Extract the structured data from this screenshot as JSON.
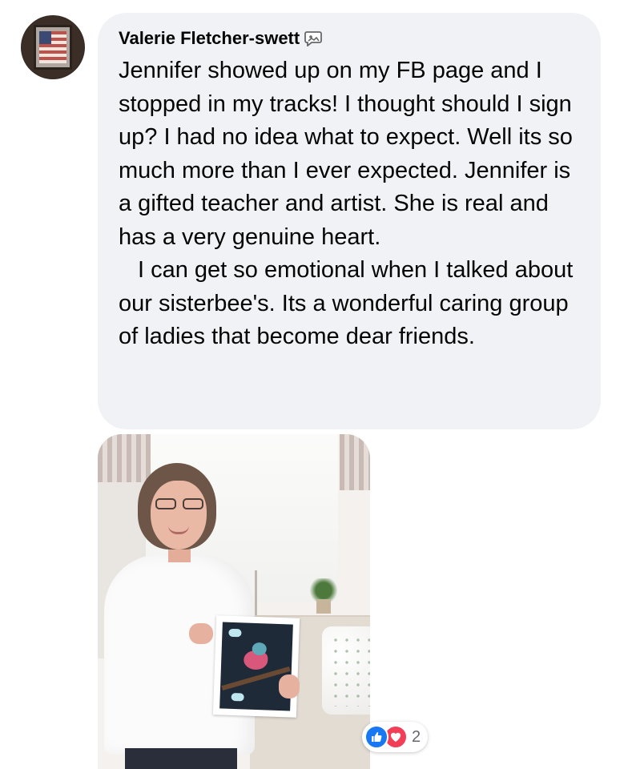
{
  "comment": {
    "author": "Valerie Fletcher-swett",
    "author_badge_icon": "speech-bubble-badge-icon",
    "paragraphs": [
      "Jennifer showed up on my FB page and I stopped in my tracks! I thought should I sign up? I had no idea what to expect. Well its so much more than I ever expected. Jennifer is a gifted teacher and artist. She is real and has a very genuine heart.",
      "I can get so emotional when I talked about our sisterbee's. Its a wonderful caring group of ladies that become dear friends."
    ]
  },
  "reactions": {
    "icons": [
      "like-icon",
      "love-icon"
    ],
    "count": "2",
    "like_color": "#1877f2",
    "love_color": "#f33e58"
  },
  "colors": {
    "bubble_background": "#f0f2f5",
    "text": "#050505",
    "meta_text": "#65676b"
  }
}
